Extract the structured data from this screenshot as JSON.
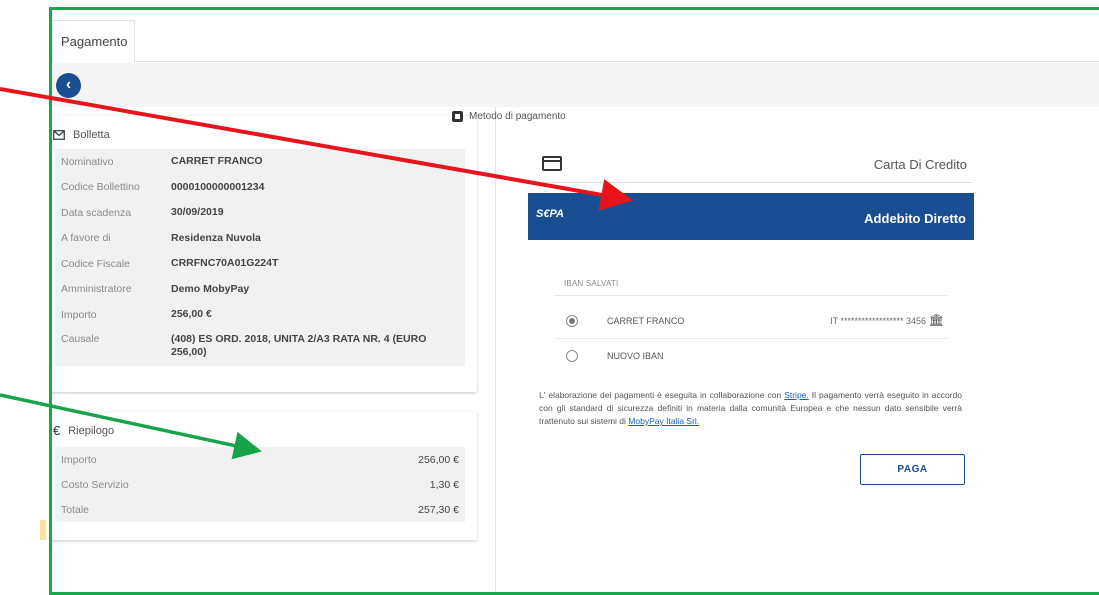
{
  "tab": {
    "label": "Pagamento"
  },
  "back": {
    "glyph": "‹"
  },
  "bolletta": {
    "title": "Bolletta",
    "rows": [
      {
        "label": "Nominativo",
        "value": "CARRET FRANCO"
      },
      {
        "label": "Codice Bollettino",
        "value": "0000100000001234"
      },
      {
        "label": "Data scadenza",
        "value": "30/09/2019"
      },
      {
        "label": "A favore di",
        "value": "Residenza Nuvola"
      },
      {
        "label": "Codice Fiscale",
        "value": "CRRFNC70A01G224T"
      },
      {
        "label": "Amministratore",
        "value": "Demo MobyPay"
      },
      {
        "label": "Importo",
        "value": "256,00 €"
      },
      {
        "label": "Causale",
        "value": "(408) ES ORD. 2018, UNITA 2/A3 RATA NR. 4 (EURO 256,00)"
      }
    ]
  },
  "riepilogo": {
    "icon": "€",
    "title": "Riepilogo",
    "rows": [
      {
        "label": "Importo",
        "value": "256,00 €"
      },
      {
        "label": "Costo Servizio",
        "value": "1,30 €"
      },
      {
        "label": "Totale",
        "value": "257,30 €"
      }
    ]
  },
  "metodo": {
    "title": "Metodo di pagamento",
    "credit_label": "Carta Di Credito",
    "sepa_logo": "S€PA",
    "sepa_label": "Addebito Diretto"
  },
  "iban": {
    "title": "IBAN SALVATI",
    "saved_name": "CARRET FRANCO",
    "saved_number": "IT ****************** 3456",
    "new_label": "NUOVO IBAN"
  },
  "info": {
    "part1": "L' elaborazione dei pagamenti è eseguita in collaborazione con ",
    "link1": "Stripe.",
    "part2": " Il pagamento verrà eseguito in accordo con gli standard di sicurezza definiti in materia dalla comunità Europea e che nessun dato sensibile verrà trattenuto sui sistemi di ",
    "link2": "MobyPay Italia Srl."
  },
  "pay": {
    "label": "PAGA"
  },
  "colors": {
    "primary": "#194e93",
    "frame": "#1aa64a",
    "arrow_red": "#e8141b",
    "arrow_green": "#16a34a"
  }
}
